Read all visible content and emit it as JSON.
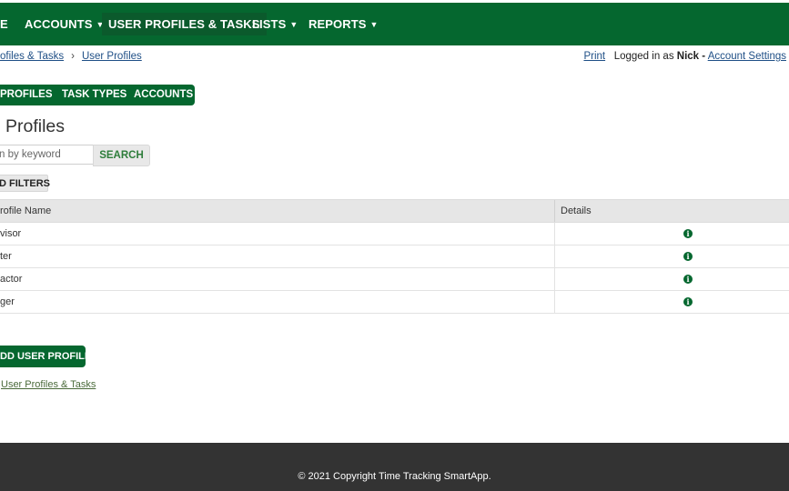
{
  "nav": {
    "home_fragment": "E",
    "items": [
      {
        "label": "ACCOUNTS",
        "has_menu": true
      },
      {
        "label": "USER PROFILES & TASKS",
        "has_menu": false
      },
      {
        "label": "LISTS",
        "has_menu": true
      },
      {
        "label": "REPORTS",
        "has_menu": true
      }
    ],
    "caret": "▼"
  },
  "breadcrumb": {
    "parent": "ofiles & Tasks",
    "separator": "›",
    "current": "User Profiles"
  },
  "account": {
    "print": "Print",
    "logged_in_prefix": "Logged in as",
    "user": "Nick",
    "dash": "-",
    "settings": "Account Settings"
  },
  "tabs": [
    {
      "label": "PROFILES"
    },
    {
      "label": "TASK TYPES"
    },
    {
      "label": "ACCOUNTS"
    }
  ],
  "page_title": "Profiles",
  "search": {
    "placeholder": "n by keyword",
    "button": "SEARCH"
  },
  "filters_button": "D FILTERS",
  "table": {
    "columns": [
      "rofile Name",
      "Details"
    ],
    "rows": [
      {
        "name": "visor"
      },
      {
        "name": "ter"
      },
      {
        "name": "actor"
      },
      {
        "name": "ger"
      }
    ],
    "info_glyph": "i"
  },
  "add_button": "DD USER PROFILE",
  "back_link": "User Profiles & Tasks",
  "footer": "© 2021 Copyright Time Tracking SmartApp.",
  "colors": {
    "brand_green": "#05672f",
    "footer_bg": "#333333",
    "link_blue": "#1f4f86"
  }
}
